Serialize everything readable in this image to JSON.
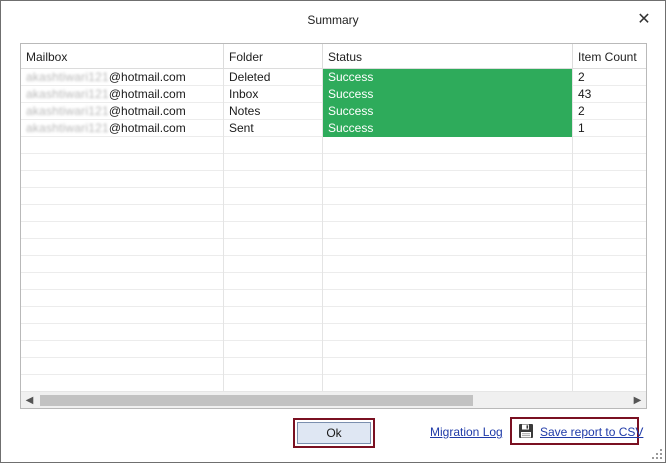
{
  "window": {
    "title": "Summary",
    "close_glyph": "✕"
  },
  "table": {
    "columns": [
      "Mailbox",
      "Folder",
      "Status",
      "Item Count"
    ],
    "rows": [
      {
        "mailbox_blurred": "akashtiwari121",
        "mailbox_domain": "@hotmail.com",
        "folder": "Deleted",
        "status": "Success",
        "count": "2"
      },
      {
        "mailbox_blurred": "akashtiwari121",
        "mailbox_domain": "@hotmail.com",
        "folder": "Inbox",
        "status": "Success",
        "count": "43"
      },
      {
        "mailbox_blurred": "akashtiwari121",
        "mailbox_domain": "@hotmail.com",
        "folder": "Notes",
        "status": "Success",
        "count": "2"
      },
      {
        "mailbox_blurred": "akashtiwari121",
        "mailbox_domain": "@hotmail.com",
        "folder": "Sent",
        "status": "Success",
        "count": "1"
      }
    ]
  },
  "scrollbar": {
    "left_arrow": "◀",
    "right_arrow": "▶"
  },
  "footer": {
    "ok_label": "Ok",
    "migration_log_label": "Migration Log",
    "save_csv_label": "Save report to CSV"
  },
  "icons": {
    "close": "close-icon",
    "save": "floppy-disk-icon",
    "grip": "resize-grip-icon"
  },
  "colors": {
    "status_success": "#2eab5b",
    "highlight_border": "#7a1021",
    "link": "#1f3aa8"
  }
}
